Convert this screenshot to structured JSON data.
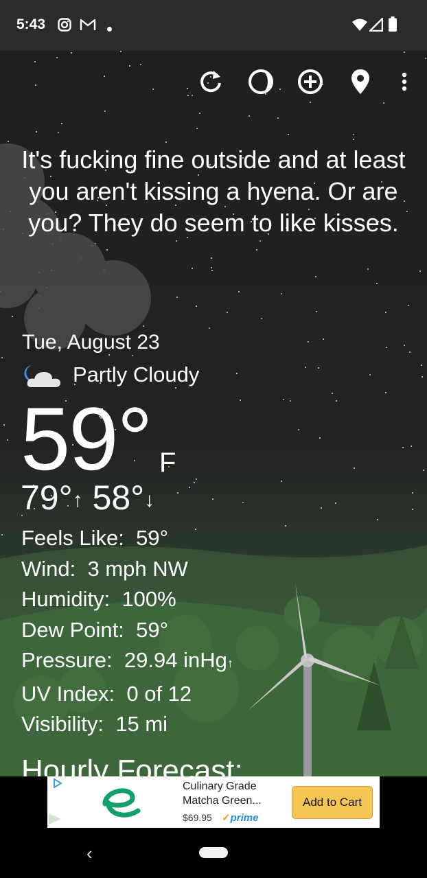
{
  "status_bar": {
    "time": "5:43"
  },
  "toolbar": {
    "icons": [
      "refresh-icon",
      "moon-phase-icon",
      "add-icon",
      "location-pin-icon",
      "overflow-menu-icon"
    ]
  },
  "quote": "It's fucking fine outside and at least you aren't kissing a hyena. Or are you? They do seem to like kisses.",
  "weather": {
    "date": "Tue, August 23",
    "condition": "Partly Cloudy",
    "temperature": "59°",
    "unit": "F",
    "high": "79°",
    "low": "58°",
    "details": [
      {
        "label": "Feels Like:",
        "value": "59°"
      },
      {
        "label": "Wind:",
        "value": "3 mph NW"
      },
      {
        "label": "Humidity:",
        "value": "100%"
      },
      {
        "label": "Dew Point:",
        "value": "59°"
      },
      {
        "label": "Pressure:",
        "value": "29.94 inHg"
      },
      {
        "label": "UV Index:",
        "value": "0 of 12"
      },
      {
        "label": "Visibility:",
        "value": "15 mi"
      }
    ],
    "hourly_heading": "Hourly Forecast:"
  },
  "ad": {
    "title": "Culinary Grade Matcha Green...",
    "price": "$69.95",
    "prime_label": "prime",
    "button_label": "Add to Cart"
  },
  "colors": {
    "sky": "#1f1f1f",
    "hills": "#3c5a3b",
    "ad_button": "#f6c552"
  }
}
